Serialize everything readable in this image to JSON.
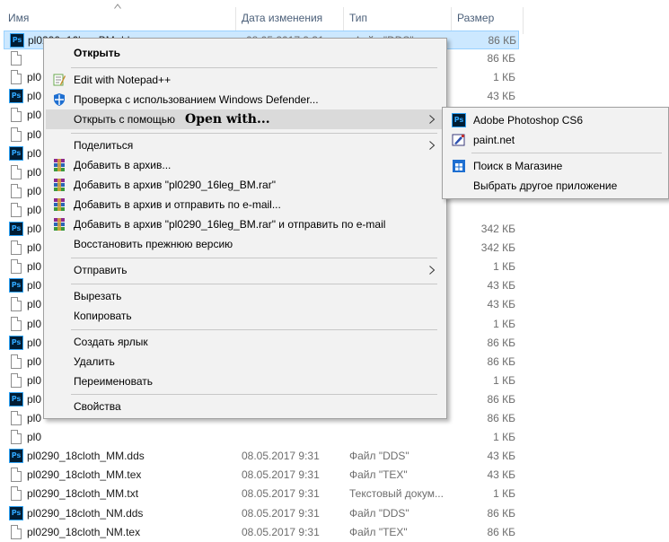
{
  "columns": {
    "name": "Имя",
    "date": "Дата изменения",
    "type": "Тип",
    "size": "Размер"
  },
  "files": [
    {
      "icon": "ps",
      "name": "pl0290_16leg_BM.dds",
      "date": "08.05.2017 9:31",
      "type": "Файл \"DDS\"",
      "size": "86 КБ",
      "selected": true
    },
    {
      "icon": "doc",
      "name": "",
      "date": "",
      "type": "",
      "size": "86 КБ"
    },
    {
      "icon": "doc",
      "name": "pl0",
      "date": "",
      "type": "",
      "size": "1 КБ"
    },
    {
      "icon": "ps",
      "name": "pl0",
      "date": "",
      "type": "",
      "size": "43 КБ"
    },
    {
      "icon": "doc",
      "name": "pl0",
      "date": "",
      "type": "",
      "size": ""
    },
    {
      "icon": "doc",
      "name": "pl0",
      "date": "",
      "type": "",
      "size": ""
    },
    {
      "icon": "ps",
      "name": "pl0",
      "date": "",
      "type": "",
      "size": ""
    },
    {
      "icon": "doc",
      "name": "pl0",
      "date": "",
      "type": "",
      "size": ""
    },
    {
      "icon": "doc",
      "name": "pl0",
      "date": "",
      "type": "",
      "size": ""
    },
    {
      "icon": "doc",
      "name": "pl0",
      "date": "",
      "type": "",
      "size": ""
    },
    {
      "icon": "ps",
      "name": "pl0",
      "date": "",
      "type": "",
      "size": "342 КБ"
    },
    {
      "icon": "doc",
      "name": "pl0",
      "date": "",
      "type": "",
      "size": "342 КБ"
    },
    {
      "icon": "doc",
      "name": "pl0",
      "date": "",
      "type": "",
      "size": "1 КБ"
    },
    {
      "icon": "ps",
      "name": "pl0",
      "date": "",
      "type": "",
      "size": "43 КБ"
    },
    {
      "icon": "doc",
      "name": "pl0",
      "date": "",
      "type": "",
      "size": "43 КБ"
    },
    {
      "icon": "doc",
      "name": "pl0",
      "date": "",
      "type": "",
      "size": "1 КБ"
    },
    {
      "icon": "ps",
      "name": "pl0",
      "date": "",
      "type": "",
      "size": "86 КБ"
    },
    {
      "icon": "doc",
      "name": "pl0",
      "date": "",
      "type": "",
      "size": "86 КБ"
    },
    {
      "icon": "doc",
      "name": "pl0",
      "date": "",
      "type": "",
      "size": "1 КБ"
    },
    {
      "icon": "ps",
      "name": "pl0",
      "date": "",
      "type": "",
      "size": "86 КБ"
    },
    {
      "icon": "doc",
      "name": "pl0",
      "date": "",
      "type": "",
      "size": "86 КБ"
    },
    {
      "icon": "doc",
      "name": "pl0",
      "date": "",
      "type": "",
      "size": "1 КБ"
    },
    {
      "icon": "ps",
      "name": "pl0290_18cloth_MM.dds",
      "date": "08.05.2017 9:31",
      "type": "Файл \"DDS\"",
      "size": "43 КБ"
    },
    {
      "icon": "doc",
      "name": "pl0290_18cloth_MM.tex",
      "date": "08.05.2017 9:31",
      "type": "Файл \"TEX\"",
      "size": "43 КБ"
    },
    {
      "icon": "doc",
      "name": "pl0290_18cloth_MM.txt",
      "date": "08.05.2017 9:31",
      "type": "Текстовый докум...",
      "size": "1 КБ"
    },
    {
      "icon": "ps",
      "name": "pl0290_18cloth_NM.dds",
      "date": "08.05.2017 9:31",
      "type": "Файл \"DDS\"",
      "size": "86 КБ"
    },
    {
      "icon": "doc",
      "name": "pl0290_18cloth_NM.tex",
      "date": "08.05.2017 9:31",
      "type": "Файл \"TEX\"",
      "size": "86 КБ"
    }
  ],
  "context_menu": {
    "open": "Открыть",
    "edit_notepad": "Edit with Notepad++",
    "defender_scan": "Проверка с использованием Windows Defender...",
    "open_with": "Открыть с помощью",
    "open_with_note": "Open with...",
    "share": "Поделиться",
    "add_archive": "Добавить в архив...",
    "add_archive_named": "Добавить в архив \"pl0290_16leg_BM.rar\"",
    "add_archive_email": "Добавить в архив и отправить по e-mail...",
    "add_archive_named_email": "Добавить в архив \"pl0290_16leg_BM.rar\" и отправить по e-mail",
    "restore_previous": "Восстановить прежнюю версию",
    "send_to": "Отправить",
    "cut": "Вырезать",
    "copy": "Копировать",
    "create_shortcut": "Создать ярлык",
    "delete": "Удалить",
    "rename": "Переименовать",
    "properties": "Свойства"
  },
  "open_with_submenu": {
    "photoshop": "Adobe Photoshop CS6",
    "paintnet": "paint.net",
    "store_search": "Поиск в Магазине",
    "choose_other": "Выбрать другое приложение"
  },
  "colors": {
    "selection": "#cce8ff",
    "menu_bg": "#f2f2f2",
    "highlight": "#dadada",
    "header_text": "#4c607a"
  }
}
